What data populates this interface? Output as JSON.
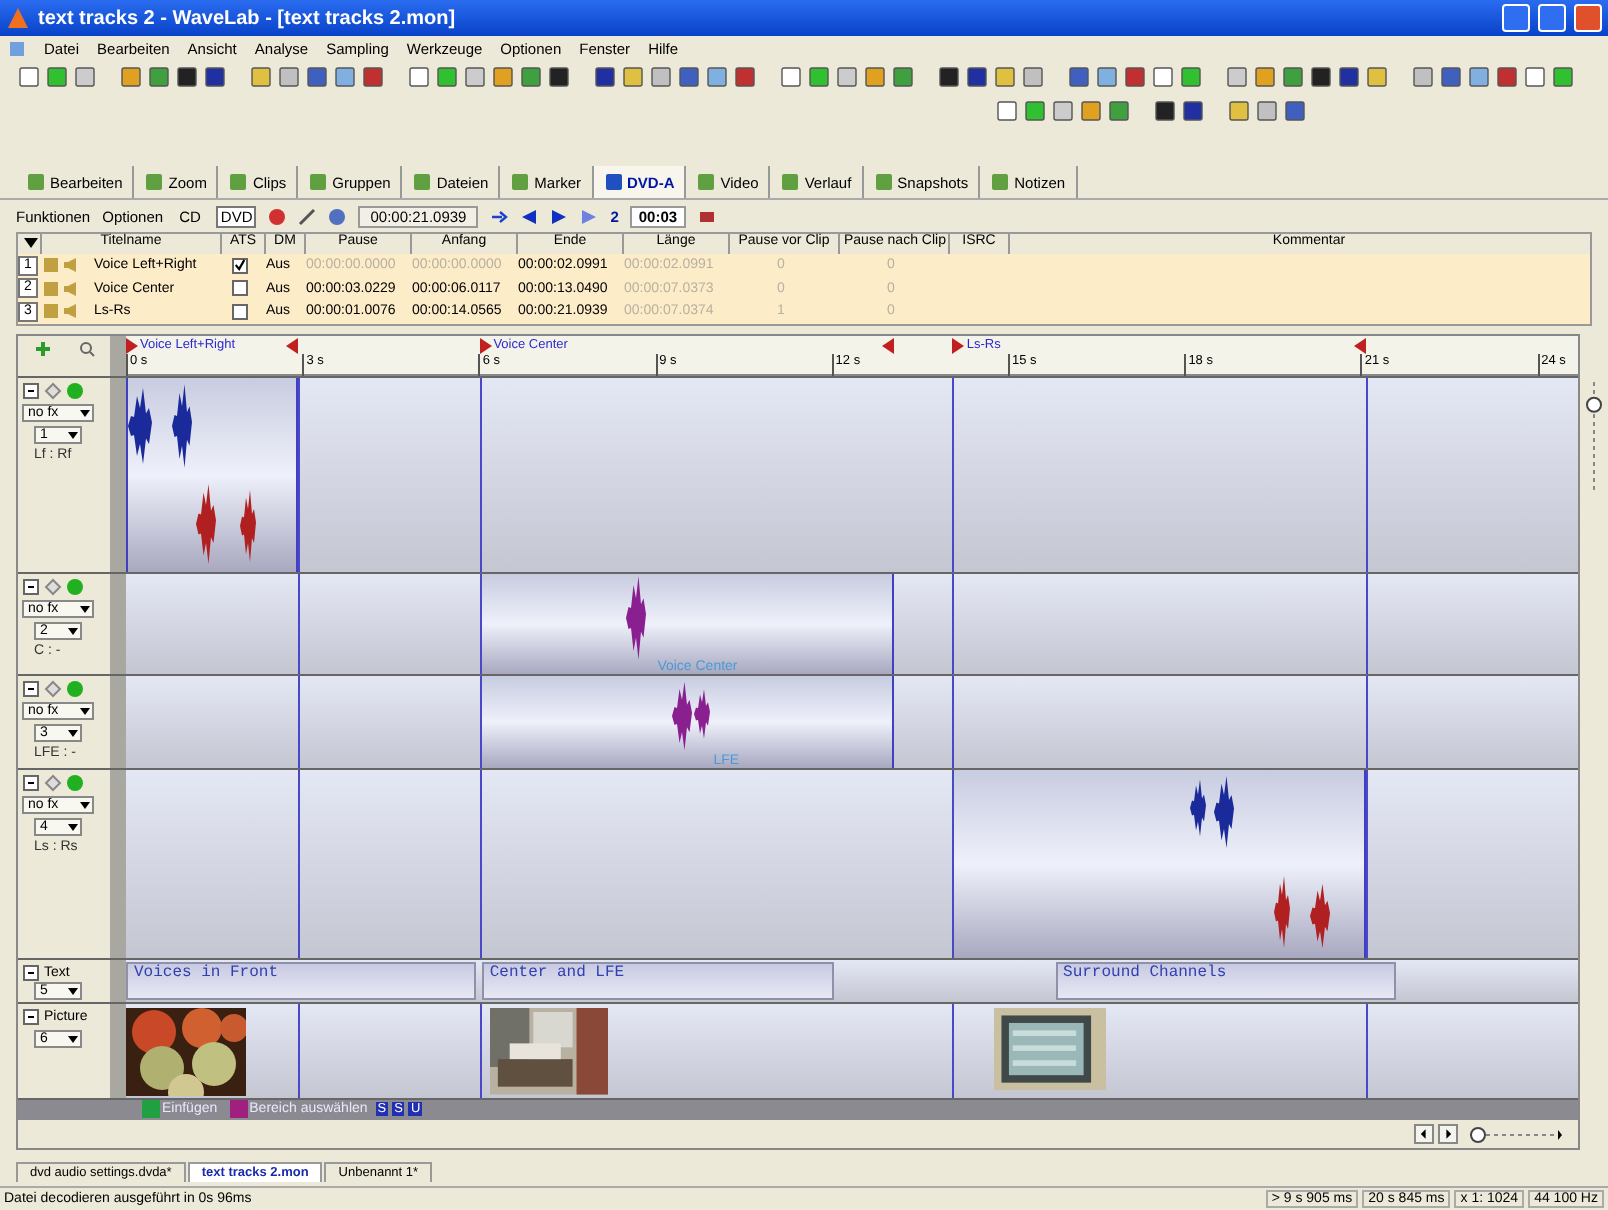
{
  "window": {
    "title": "text tracks 2 - WaveLab - [text tracks 2.mon]"
  },
  "menu": [
    "Datei",
    "Bearbeiten",
    "Ansicht",
    "Analyse",
    "Sampling",
    "Werkzeuge",
    "Optionen",
    "Fenster",
    "Hilfe"
  ],
  "tabs": [
    {
      "label": "Bearbeiten",
      "selected": false
    },
    {
      "label": "Zoom",
      "selected": false
    },
    {
      "label": "Clips",
      "selected": false
    },
    {
      "label": "Gruppen",
      "selected": false
    },
    {
      "label": "Dateien",
      "selected": false
    },
    {
      "label": "Marker",
      "selected": false
    },
    {
      "label": "DVD-A",
      "selected": true
    },
    {
      "label": "Video",
      "selected": false
    },
    {
      "label": "Verlauf",
      "selected": false
    },
    {
      "label": "Snapshots",
      "selected": false
    },
    {
      "label": "Notizen",
      "selected": false
    }
  ],
  "function_bar": {
    "menus": [
      "Funktionen",
      "Optionen"
    ],
    "formats": [
      {
        "label": "CD",
        "selected": false
      },
      {
        "label": "DVD",
        "selected": true
      }
    ],
    "time": "00:00:21.0939",
    "count": "2",
    "duration": "00:03"
  },
  "title_table": {
    "columns": [
      "Titelname",
      "ATS",
      "DM",
      "Pause",
      "Anfang",
      "Ende",
      "Länge",
      "Pause vor Clip",
      "Pause nach Clip",
      "ISRC",
      "Kommentar"
    ],
    "rows": [
      {
        "number": "1",
        "name": "Voice Left+Right",
        "ats": true,
        "dm": "Aus",
        "auto_start": true,
        "pause": "00:00:00.0000",
        "start": "00:00:00.0000",
        "end": "00:00:02.0991",
        "length": "00:00:02.0991",
        "pause_before": "0",
        "pause_after": "0"
      },
      {
        "number": "2",
        "name": "Voice Center",
        "ats": false,
        "dm": "Aus",
        "auto_start": false,
        "pause": "00:00:03.0229",
        "start": "00:00:06.0117",
        "end": "00:00:13.0490",
        "length": "00:00:07.0373",
        "pause_before": "0",
        "pause_after": "0"
      },
      {
        "number": "3",
        "name": "Ls-Rs",
        "ats": false,
        "dm": "Aus",
        "auto_start": false,
        "pause": "00:00:01.0076",
        "start": "00:00:14.0565",
        "end": "00:00:21.0939",
        "length": "00:00:07.0374",
        "pause_before": "1",
        "pause_after": "0"
      }
    ]
  },
  "timeline": {
    "markers": [
      "Voice Left+Right",
      "Voice Center",
      "Ls-Rs"
    ],
    "ticks": [
      "0 s",
      "3 s",
      "6 s",
      "9 s",
      "12 s",
      "15 s",
      "18 s",
      "21 s",
      "24 s"
    ]
  },
  "tracks": [
    {
      "kind": "audio",
      "fx": "no fx",
      "number": "1",
      "channels": "Lf : Rf"
    },
    {
      "kind": "audio",
      "fx": "no fx",
      "number": "2",
      "channels": "C : -",
      "clip_label": "Voice Center"
    },
    {
      "kind": "audio",
      "fx": "no fx",
      "number": "3",
      "channels": "LFE : -",
      "clip_label": "LFE"
    },
    {
      "kind": "audio",
      "fx": "no fx",
      "number": "4",
      "channels": "Ls : Rs"
    },
    {
      "kind": "text",
      "name": "Text",
      "number": "5",
      "clips": [
        "Voices in Front",
        "Center and LFE",
        "Surround Channels"
      ]
    },
    {
      "kind": "picture",
      "name": "Picture",
      "number": "6"
    }
  ],
  "zoom": {
    "horizontal": {
      "level": 0.1
    },
    "vertical": {
      "level": 0.82
    }
  },
  "edit_bar": {
    "items": [
      "Einfügen",
      "Bereich auswählen"
    ],
    "flags": [
      "S",
      "S",
      "U"
    ]
  },
  "documents": [
    {
      "label": "dvd audio settings.dvda*",
      "selected": false
    },
    {
      "label": "text tracks 2.mon",
      "selected": true
    },
    {
      "label": "Unbenannt 1*",
      "selected": false
    }
  ],
  "status_bar": {
    "message": "Datei decodieren ausgeführt in 0s 96ms",
    "fields": [
      "> 9 s 905 ms",
      "20 s 845 ms",
      "x 1: 1024",
      "44 100 Hz"
    ]
  }
}
